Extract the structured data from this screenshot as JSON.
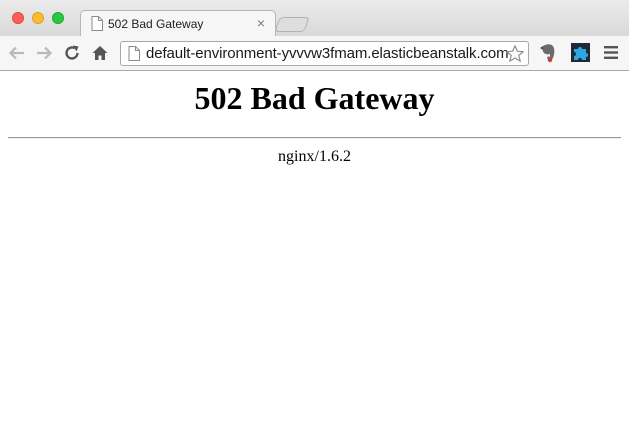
{
  "window": {
    "controls": [
      "close",
      "minimize",
      "maximize"
    ]
  },
  "tab": {
    "title": "502 Bad Gateway",
    "close_glyph": "×",
    "icon": "page-icon"
  },
  "toolbar": {
    "back_icon": "arrow-left-icon",
    "forward_icon": "arrow-right-icon",
    "reload_icon": "reload-icon",
    "home_icon": "home-icon",
    "url": "default-environment-yvvvw3fmam.elasticbeanstalk.com",
    "bookmark_icon": "star-icon",
    "extensions": [
      "evernote-icon",
      "puzzle-extension-icon"
    ],
    "menu_icon": "hamburger-menu-icon"
  },
  "page": {
    "heading": "502 Bad Gateway",
    "server": "nginx/1.6.2"
  }
}
